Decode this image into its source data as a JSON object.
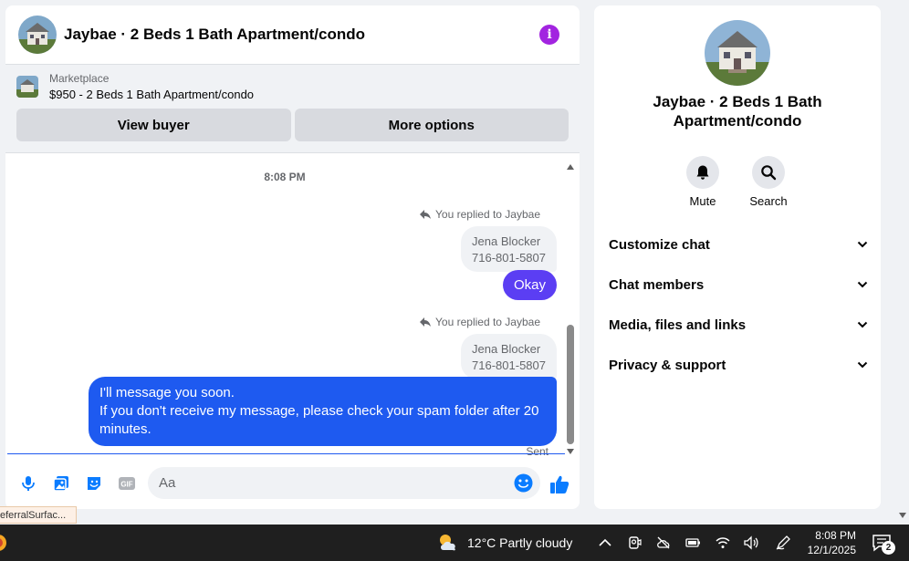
{
  "header": {
    "title": "Jaybae · 2 Beds 1 Bath Apartment/condo",
    "info_icon": "i"
  },
  "marketplace": {
    "label": "Marketplace",
    "item": "$950 - 2 Beds 1 Bath Apartment/condo",
    "view_buyer": "View buyer",
    "more_options": "More options"
  },
  "messages": {
    "time": "8:08 PM",
    "replies": [
      {
        "replied_label": "You replied to Jaybae",
        "quoted_lines": [
          "Jena Blocker",
          "716-801-5807"
        ],
        "reply": "Okay"
      },
      {
        "replied_label": "You replied to Jaybae",
        "quoted_lines": [
          "Jena Blocker",
          "716-801-5807"
        ],
        "reply_lines": [
          "I'll message you soon.",
          "If you don't receive my message, please check your spam folder after 20",
          "minutes."
        ]
      }
    ],
    "status": "Sent"
  },
  "composer": {
    "placeholder": "Aa"
  },
  "info_panel": {
    "title": "Jaybae · 2 Beds 1 Bath Apartment/condo",
    "actions": [
      {
        "label": "Mute",
        "icon": "bell-icon"
      },
      {
        "label": "Search",
        "icon": "search-icon"
      }
    ],
    "sections": [
      "Customize chat",
      "Chat members",
      "Media, files and links",
      "Privacy & support"
    ]
  },
  "tooltip": "eferralSurfac...",
  "taskbar": {
    "weather": "12°C  Partly cloudy",
    "time": "8:08 PM",
    "date": "12/1/2025",
    "notification_count": "2"
  },
  "colors": {
    "accent_blue": "#1e5af0",
    "accent_purple": "#5b3ef3",
    "info_purple": "#a224e0",
    "messenger_blue": "#0a7cff"
  }
}
